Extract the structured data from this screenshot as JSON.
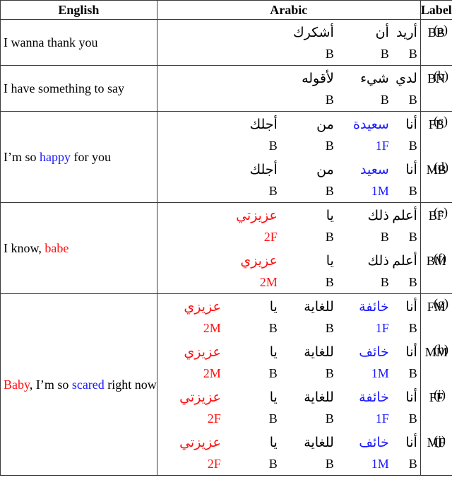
{
  "header": {
    "english": "English",
    "arabic": "Arabic",
    "label": "Label"
  },
  "colors": {
    "female_or_first_person_tag": "#1a1aff",
    "addressee_tag": "#ff0f0f",
    "default": "#000000"
  },
  "groups": [
    {
      "english": [
        {
          "text": "I wanna thank you",
          "color": "default"
        }
      ],
      "rows": [
        {
          "id": "(a)",
          "label": "BB",
          "words": [
            {
              "ar": "أريد",
              "tag": "B",
              "color": "default"
            },
            {
              "ar": "أن",
              "tag": "B",
              "color": "default"
            },
            {
              "ar": "أشكرك",
              "tag": "B",
              "color": "default"
            }
          ]
        }
      ]
    },
    {
      "english": [
        {
          "text": "I have something to say",
          "color": "default"
        }
      ],
      "rows": [
        {
          "id": "(b)",
          "label": "BN",
          "words": [
            {
              "ar": "لدي",
              "tag": "B",
              "color": "default"
            },
            {
              "ar": "شيء",
              "tag": "B",
              "color": "default"
            },
            {
              "ar": "لأقوله",
              "tag": "B",
              "color": "default"
            }
          ]
        }
      ]
    },
    {
      "english": [
        {
          "text": "I’m so ",
          "color": "default"
        },
        {
          "text": "happy",
          "color": "blue"
        },
        {
          "text": " for you",
          "color": "default"
        }
      ],
      "rows": [
        {
          "id": "(c)",
          "label": "FB",
          "words": [
            {
              "ar": "أنا",
              "tag": "B",
              "color": "default"
            },
            {
              "ar": "سعيدة",
              "tag": "1F",
              "color": "blue"
            },
            {
              "ar": "من",
              "tag": "B",
              "color": "default"
            },
            {
              "ar": "أجلك",
              "tag": "B",
              "color": "default"
            }
          ]
        },
        {
          "id": "(d)",
          "label": "MB",
          "words": [
            {
              "ar": "أنا",
              "tag": "B",
              "color": "default"
            },
            {
              "ar": "سعيد",
              "tag": "1M",
              "color": "blue"
            },
            {
              "ar": "من",
              "tag": "B",
              "color": "default"
            },
            {
              "ar": "أجلك",
              "tag": "B",
              "color": "default"
            }
          ]
        }
      ]
    },
    {
      "english": [
        {
          "text": "I know, ",
          "color": "default"
        },
        {
          "text": "babe",
          "color": "red"
        }
      ],
      "rows": [
        {
          "id": "(e)",
          "label": "BF",
          "words": [
            {
              "ar": "أعلم",
              "tag": "B",
              "color": "default"
            },
            {
              "ar": "ذلك",
              "tag": "B",
              "color": "default"
            },
            {
              "ar": "يا",
              "tag": "B",
              "color": "default"
            },
            {
              "ar": "عزيزتي",
              "tag": "2F",
              "color": "red"
            }
          ]
        },
        {
          "id": "(f)",
          "label": "BM",
          "words": [
            {
              "ar": "أعلم",
              "tag": "B",
              "color": "default"
            },
            {
              "ar": "ذلك",
              "tag": "B",
              "color": "default"
            },
            {
              "ar": "يا",
              "tag": "B",
              "color": "default"
            },
            {
              "ar": "عزيزي",
              "tag": "2M",
              "color": "red"
            }
          ]
        }
      ]
    },
    {
      "english": [
        {
          "text": "Baby",
          "color": "red"
        },
        {
          "text": ", I’m so ",
          "color": "default"
        },
        {
          "text": "scared",
          "color": "blue"
        },
        {
          "text": " right now",
          "color": "default"
        }
      ],
      "rows": [
        {
          "id": "(g)",
          "label": "FM",
          "words": [
            {
              "ar": "أنا",
              "tag": "B",
              "color": "default"
            },
            {
              "ar": "خائفة",
              "tag": "1F",
              "color": "blue"
            },
            {
              "ar": "للغاية",
              "tag": "B",
              "color": "default"
            },
            {
              "ar": "يا",
              "tag": "B",
              "color": "default"
            },
            {
              "ar": "عزيزي",
              "tag": "2M",
              "color": "red"
            }
          ]
        },
        {
          "id": "(h)",
          "label": "MM",
          "words": [
            {
              "ar": "أنا",
              "tag": "B",
              "color": "default"
            },
            {
              "ar": "خائف",
              "tag": "1M",
              "color": "blue"
            },
            {
              "ar": "للغاية",
              "tag": "B",
              "color": "default"
            },
            {
              "ar": "يا",
              "tag": "B",
              "color": "default"
            },
            {
              "ar": "عزيزي",
              "tag": "2M",
              "color": "red"
            }
          ]
        },
        {
          "id": "(i)",
          "label": "FF",
          "words": [
            {
              "ar": "أنا",
              "tag": "B",
              "color": "default"
            },
            {
              "ar": "خائفة",
              "tag": "1F",
              "color": "blue"
            },
            {
              "ar": "للغاية",
              "tag": "B",
              "color": "default"
            },
            {
              "ar": "يا",
              "tag": "B",
              "color": "default"
            },
            {
              "ar": "عزيزتي",
              "tag": "2F",
              "color": "red"
            }
          ]
        },
        {
          "id": "(j)",
          "label": "MF",
          "words": [
            {
              "ar": "أنا",
              "tag": "B",
              "color": "default"
            },
            {
              "ar": "خائف",
              "tag": "1M",
              "color": "blue"
            },
            {
              "ar": "للغاية",
              "tag": "B",
              "color": "default"
            },
            {
              "ar": "يا",
              "tag": "B",
              "color": "default"
            },
            {
              "ar": "عزيزتي",
              "tag": "2F",
              "color": "red"
            }
          ]
        }
      ]
    }
  ]
}
